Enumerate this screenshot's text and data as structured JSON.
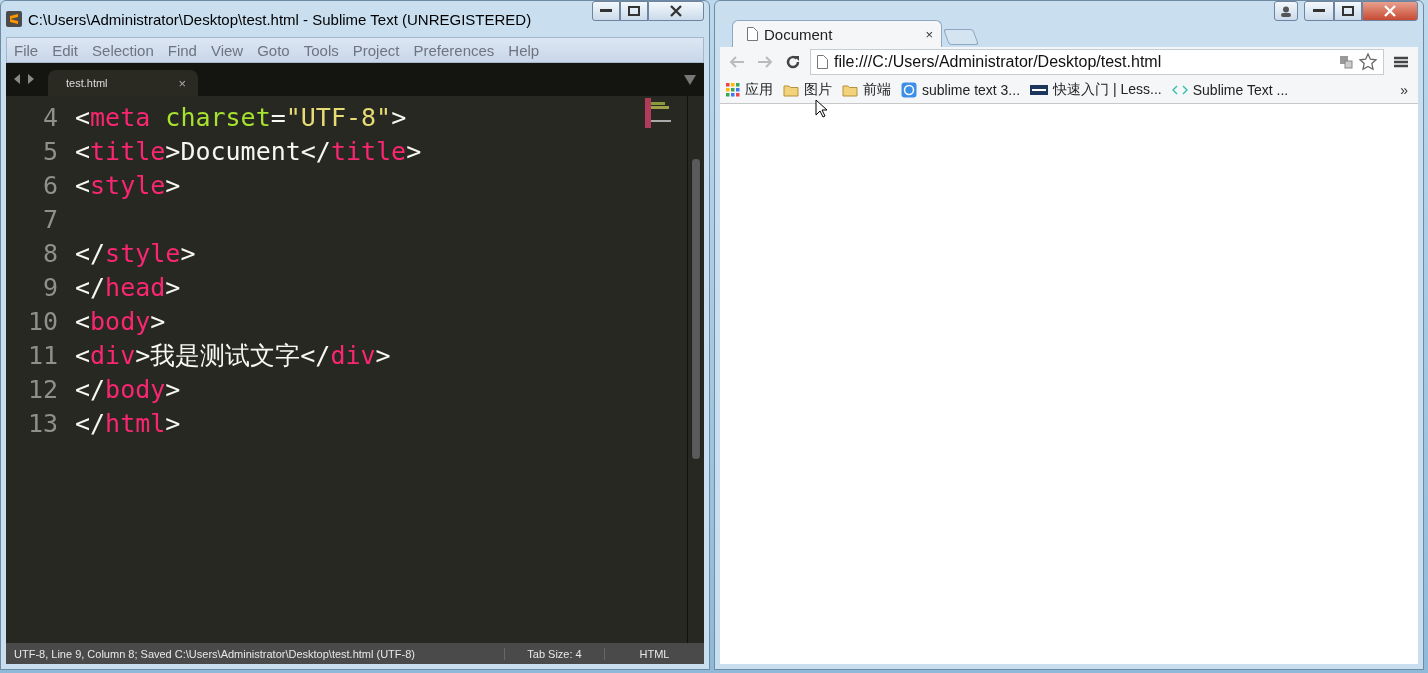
{
  "editor": {
    "title": "C:\\Users\\Administrator\\Desktop\\test.html - Sublime Text (UNREGISTERED)",
    "menu": [
      "File",
      "Edit",
      "Selection",
      "Find",
      "View",
      "Goto",
      "Tools",
      "Project",
      "Preferences",
      "Help"
    ],
    "tab": {
      "label": "test.html",
      "close": "×",
      "selected": true
    },
    "lines": [
      {
        "number": "4",
        "tokens": [
          {
            "kind": "punct",
            "text": "<"
          },
          {
            "kind": "tag",
            "text": "meta"
          },
          {
            "kind": "attr",
            "text": " charset"
          },
          {
            "kind": "punct",
            "text": "="
          },
          {
            "kind": "string",
            "text": "\"UTF-8\""
          },
          {
            "kind": "punct",
            "text": ">"
          }
        ]
      },
      {
        "number": "5",
        "tokens": [
          {
            "kind": "punct",
            "text": "<"
          },
          {
            "kind": "tag",
            "text": "title"
          },
          {
            "kind": "punct",
            "text": ">Document</"
          },
          {
            "kind": "tag",
            "text": "title"
          },
          {
            "kind": "punct",
            "text": ">"
          }
        ]
      },
      {
        "number": "6",
        "tokens": [
          {
            "kind": "punct",
            "text": "<"
          },
          {
            "kind": "tag",
            "text": "style"
          },
          {
            "kind": "punct",
            "text": ">"
          }
        ]
      },
      {
        "number": "7"
      },
      {
        "number": "8",
        "tokens": [
          {
            "kind": "punct",
            "text": "</"
          },
          {
            "kind": "tag",
            "text": "style"
          },
          {
            "kind": "punct",
            "text": ">"
          }
        ]
      },
      {
        "number": "9",
        "tokens": [
          {
            "kind": "punct",
            "text": "</"
          },
          {
            "kind": "tag",
            "text": "head"
          },
          {
            "kind": "punct",
            "text": ">"
          }
        ]
      },
      {
        "number": "10",
        "tokens": [
          {
            "kind": "punct",
            "text": "<"
          },
          {
            "kind": "tag",
            "text": "body"
          },
          {
            "kind": "punct",
            "text": ">"
          }
        ]
      },
      {
        "number": "11",
        "tokens": [
          {
            "kind": "punct",
            "text": "<"
          },
          {
            "kind": "tag",
            "text": "div"
          },
          {
            "kind": "punct",
            "text": ">我是测试文字</"
          },
          {
            "kind": "tag",
            "text": "div"
          },
          {
            "kind": "punct",
            "text": ">"
          }
        ]
      },
      {
        "number": "12",
        "tokens": [
          {
            "kind": "punct",
            "text": "</"
          },
          {
            "kind": "tag",
            "text": "body"
          },
          {
            "kind": "punct",
            "text": ">"
          }
        ]
      },
      {
        "number": "13",
        "tokens": [
          {
            "kind": "punct",
            "text": "</"
          },
          {
            "kind": "tag",
            "text": "html"
          },
          {
            "kind": "punct",
            "text": ">"
          }
        ]
      }
    ],
    "status": {
      "info": "UTF-8, Line 9, Column 8; Saved C:\\Users\\Administrator\\Desktop\\test.html (UTF-8)",
      "tab_size": "Tab Size: 4",
      "syntax": "HTML"
    }
  },
  "browser": {
    "tab": {
      "title": "Document",
      "close": "×",
      "selected": true
    },
    "address": "file:///C:/Users/Administrator/Desktop/test.html",
    "bookmarks": [
      {
        "label": "应用",
        "kind": "apps"
      },
      {
        "label": "图片",
        "kind": "folder"
      },
      {
        "label": "前端",
        "kind": "folder"
      },
      {
        "label": "sublime text 3...",
        "kind": "site"
      },
      {
        "label": "快速入门 | Less...",
        "kind": "less"
      },
      {
        "label": "Sublime Text ...",
        "kind": "code"
      }
    ],
    "more": "»"
  }
}
